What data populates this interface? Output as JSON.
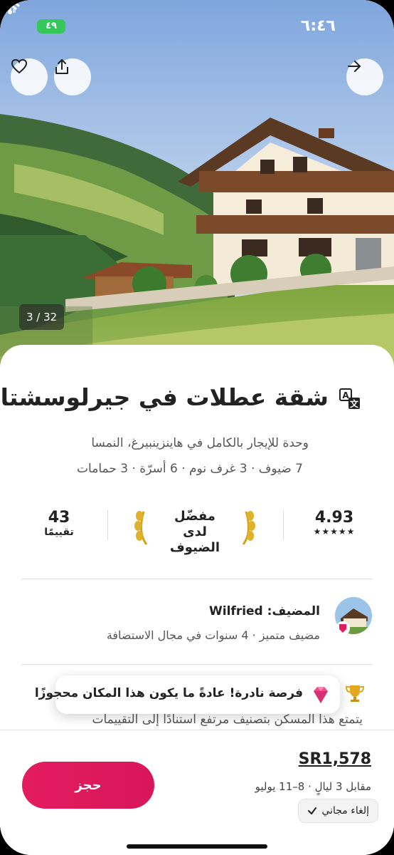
{
  "status_bar": {
    "time": "٦:٤٦",
    "battery": "٤٩"
  },
  "gallery": {
    "counter": "3 / 32"
  },
  "listing": {
    "title": "شقة عطلات في جيرلوسشتاين",
    "subtitle": "وحدة للإيجار بالكامل في هاينزينبيرغ، النمسا",
    "details": "7 ضيوف · 3 غرف نوم · 6 أسرّة · 3 حمامات"
  },
  "stats": {
    "rating": "4.93",
    "stars": "★★★★★",
    "guest_favorite_line1": "مفضّل",
    "guest_favorite_line2": "لدى الضيوف",
    "reviews_count": "43",
    "reviews_label": "تقييمًا"
  },
  "host": {
    "name": "المضيف: Wilfried",
    "meta": "مضيف متميز · 4 سنوات في مجال الاستضافة"
  },
  "rare_find": {
    "text": "فرصة نادرة! عادةً ما يكون هذا المكان محجوزًا"
  },
  "description_preview": "يتمتع هذا المسكن بتصنيف مرتفع استنادًا إلى التقييمات",
  "booking": {
    "price": "SR1,578",
    "price_detail": "مقابل 3 ليالٍ · 8–11 يوليو",
    "free_cancellation": "إلغاء مجاني",
    "reserve_label": "حجز"
  },
  "colors": {
    "brand": "#e31c5f",
    "battery": "#35c759"
  },
  "icons": [
    "heart-icon",
    "share-icon",
    "arrow-right-icon",
    "translate-icon",
    "laurel-icon",
    "trophy-icon",
    "gem-icon",
    "check-icon"
  ]
}
